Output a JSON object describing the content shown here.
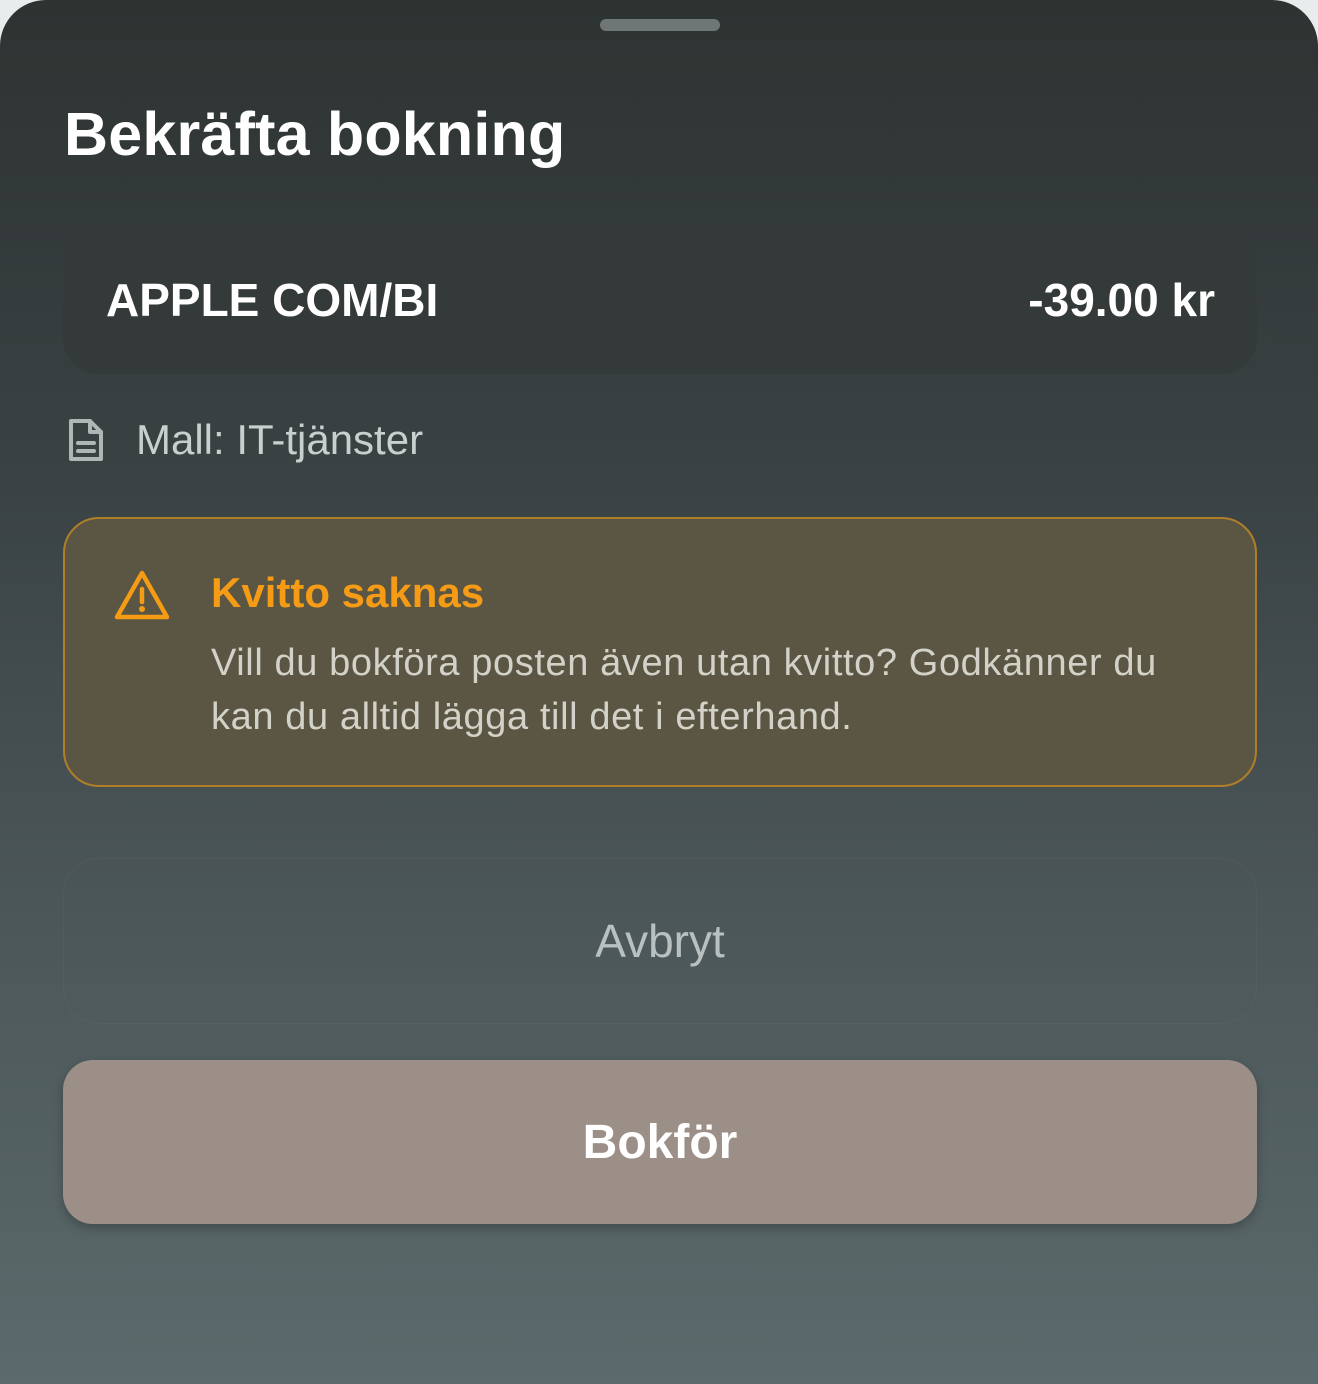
{
  "sheet": {
    "title": "Bekräfta bokning"
  },
  "transaction": {
    "merchant": "APPLE COM/BI",
    "amount": "-39.00 kr"
  },
  "template": {
    "icon": "document-icon",
    "label": "Mall: IT-tjänster"
  },
  "warning": {
    "icon": "warning-icon",
    "title": "Kvitto saknas",
    "message": "Vill du bokföra posten även utan kvitto? Godkänner du kan du alltid lägga till det i efterhand.",
    "accent_color": "#f59b15",
    "border_color": "#b07e2a"
  },
  "actions": {
    "cancel_label": "Avbryt",
    "confirm_label": "Bokför",
    "confirm_color": "#9c8f87"
  }
}
